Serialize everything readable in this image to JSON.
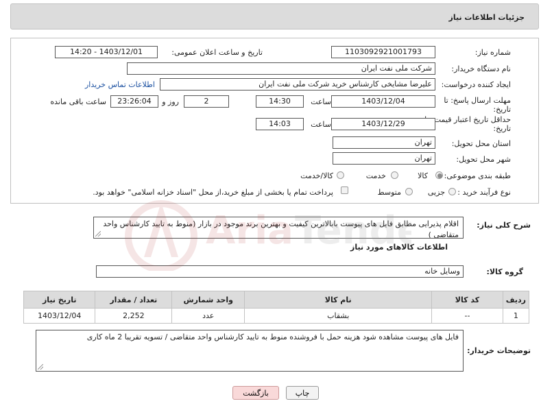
{
  "header": {
    "title": "جزئیات اطلاعات نیاز"
  },
  "labels": {
    "need_number": "شماره نیاز:",
    "announce_datetime": "تاریخ و ساعت اعلان عمومی:",
    "buyer_org": "نام دستگاه خریدار:",
    "requester": "ایجاد کننده درخواست:",
    "reply_deadline_1": "مهلت ارسال پاسخ: تا",
    "reply_deadline_2": "تاریخ:",
    "time": "ساعت",
    "days_and": "روز و",
    "remaining": "ساعت باقی مانده",
    "price_validity_1": "حداقل تاریخ اعتبار قیمت: تا",
    "price_validity_2": "تاریخ:",
    "province": "استان محل تحویل:",
    "city": "شهر محل تحویل:",
    "category": "طبقه بندی موضوعی:",
    "process": "نوع فرآیند خرید :",
    "description": "شرح کلی نیاز:",
    "goods_info": "اطلاعات کالاهای مورد نیاز",
    "goods_group": "گروه کالا:",
    "buyer_notes": "توضیحات خریدار:"
  },
  "fields": {
    "need_number": "1103092921001793",
    "announce_datetime": "1403/12/01 - 14:20",
    "buyer_org": "شرکت ملی نفت ایران",
    "requester": "علیرضا مشایخی کارشناس خرید  شرکت ملی نفت ایران",
    "contact_link": "اطلاعات تماس خریدار",
    "reply_date": "1403/12/04",
    "reply_time": "14:30",
    "reply_days": "2",
    "reply_remaining": "23:26:04",
    "validity_date": "1403/12/29",
    "validity_time": "14:03",
    "province": "تهران",
    "city": "تهران",
    "category_options": [
      "کالا",
      "خدمت",
      "کالا/خدمت"
    ],
    "process_options": [
      "جزیی",
      "متوسط"
    ],
    "payment_note": "پرداخت تمام یا بخشی از مبلغ خرید،از محل \"اسناد خزانه اسلامی\" خواهد بود.",
    "description": "اقلام پذیرایی مطابق فایل های پیوست بابالاترین کیفیت و بهترین برند موجود در بازار (منوط به تایید کارشناس واحد متقاضی )",
    "goods_group": "وسایل خانه",
    "buyer_notes": "فایل های پیوست مشاهده شود هزینه حمل با فروشنده منوط به تایید کارشناس واحد متقاضی / تسویه تقریبا 2 ماه کاری"
  },
  "table": {
    "headers": [
      "ردیف",
      "کد کالا",
      "نام کالا",
      "واحد شمارش",
      "تعداد / مقدار",
      "تاریخ نیاز"
    ],
    "rows": [
      [
        "1",
        "--",
        "بشقاب",
        "عدد",
        "2,252",
        "1403/12/04"
      ]
    ]
  },
  "buttons": {
    "print": "چاپ",
    "back": "بازگشت"
  },
  "watermark": {
    "text": "AriaTender.net"
  }
}
